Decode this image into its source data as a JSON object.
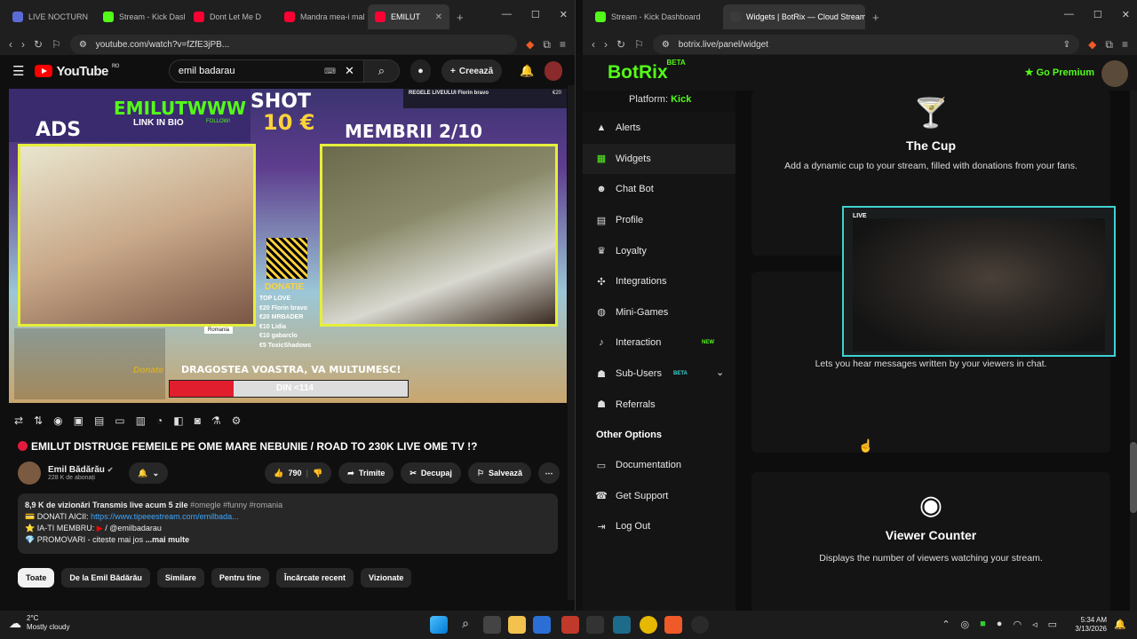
{
  "left_browser": {
    "tabs": [
      {
        "label": "LIVE NOCTURN",
        "color": "#5b6bd6",
        "active": false
      },
      {
        "label": "Stream - Kick Dash",
        "color": "#53fc18",
        "active": false
      },
      {
        "label": "Dont Let Me D",
        "color": "#ff0033",
        "active": false
      },
      {
        "label": "Mandra mea-i mal",
        "color": "#ff0033",
        "active": false
      },
      {
        "label": "EMILUT",
        "color": "#ff0033",
        "active": true
      }
    ],
    "url": "youtube.com/watch?v=fZfE3jPB...",
    "youtube": {
      "logo": "YouTube",
      "region": "RO",
      "search_value": "emil badarau",
      "create_label": "Creează",
      "video_overlay": {
        "top_text": "EMILUTWWW",
        "link_text": "LINK IN BIO",
        "follow": "FOLLOW!",
        "ads": "ADS",
        "shot": "SHOT",
        "shot_price": "10 €",
        "membrii": "MEMBRII 2/10",
        "donatie": "DONATIE",
        "donors": [
          "TOP LOVE",
          "€20 Florin bravo",
          "€20 MRBADER",
          "€10 Lidia",
          "€10 gabarclo",
          "€5 ToxicShadows"
        ],
        "banner": "DRAGOSTEA VOASTRA, VA MULTUMESC!",
        "progress": "DIN <114",
        "donate": "Donate",
        "romania": "Romania",
        "top_right": "REGELE LIVEULUI Florin bravo",
        "top_right_amount": "€20"
      },
      "title": "EMILUT DISTRUGE FEMEILE PE OME MARE NEBUNIE / ROAD TO 230K LIVE OME TV !?",
      "channel": "Emil Bădărău",
      "subscribers": "228 K de abonați",
      "likes": "790",
      "share": "Trimite",
      "clip": "Decupaj",
      "save": "Salvează",
      "desc_line1": "8,9 K de vizionări  Transmis live acum 5 zile",
      "desc_tags": "#omegle #funny #romania",
      "desc_line2_label": "DONATI AICII:",
      "desc_line2_link": "https://www.tipeeestream.com/emilbada...",
      "desc_line3": "IA-TI MEMBRU:",
      "desc_line3_handle": "/ @emilbadarau",
      "desc_line4": "PROMOVARI - citeste mai jos",
      "desc_more": "...mai multe",
      "chips": [
        "Toate",
        "De la Emil Bădărău",
        "Similare",
        "Pentru tine",
        "Încărcate recent",
        "Vizionate"
      ]
    }
  },
  "right_browser": {
    "tabs": [
      {
        "label": "Stream - Kick Dashboard",
        "color": "#53fc18",
        "active": false
      },
      {
        "label": "Widgets | BotRix — Cloud Stream",
        "color": "#3b3b3b",
        "active": true
      }
    ],
    "url": "botrix.live/panel/widget",
    "botrix": {
      "logo": "BotRix",
      "logo_badge": "BETA",
      "premium": "Go Premium",
      "platform_label": "Platform:",
      "platform_value": "Kick",
      "nav": [
        {
          "label": "Alerts",
          "icon": "alert-icon",
          "glyph": "▲"
        },
        {
          "label": "Widgets",
          "icon": "widgets-icon",
          "glyph": "▦",
          "active": true
        },
        {
          "label": "Chat Bot",
          "icon": "bot-icon",
          "glyph": "☻"
        },
        {
          "label": "Profile",
          "icon": "profile-icon",
          "glyph": "▤"
        },
        {
          "label": "Loyalty",
          "icon": "trophy-icon",
          "glyph": "♛"
        },
        {
          "label": "Integrations",
          "icon": "puzzle-icon",
          "glyph": "✣"
        },
        {
          "label": "Mini-Games",
          "icon": "gamepad-icon",
          "glyph": "◍"
        },
        {
          "label": "Interaction",
          "icon": "music-icon",
          "glyph": "♪",
          "badge": "NEW"
        },
        {
          "label": "Sub-Users",
          "icon": "users-icon",
          "glyph": "☗",
          "badge": "BETA"
        },
        {
          "label": "Referrals",
          "icon": "group-icon",
          "glyph": "☗"
        }
      ],
      "other_options": "Other Options",
      "other_nav": [
        {
          "label": "Documentation",
          "icon": "doc-icon",
          "glyph": "▭"
        },
        {
          "label": "Get Support",
          "icon": "support-icon",
          "glyph": "☎"
        },
        {
          "label": "Log Out",
          "icon": "logout-icon",
          "glyph": "⇥"
        }
      ],
      "cards": [
        {
          "title": "The Cup",
          "desc": "Add a dynamic cup to your stream, filled with donations from your fans."
        },
        {
          "title": "",
          "desc": "Lets you hear messages written by your viewers in chat."
        },
        {
          "title": "Viewer Counter",
          "desc": "Displays the number of viewers watching your stream."
        }
      ],
      "cam_live_label": "LIVE"
    }
  },
  "taskbar": {
    "weather_temp": "2°C",
    "weather_desc": "Mostly cloudy",
    "time": "5:34 AM",
    "date": "3/13/2026"
  }
}
